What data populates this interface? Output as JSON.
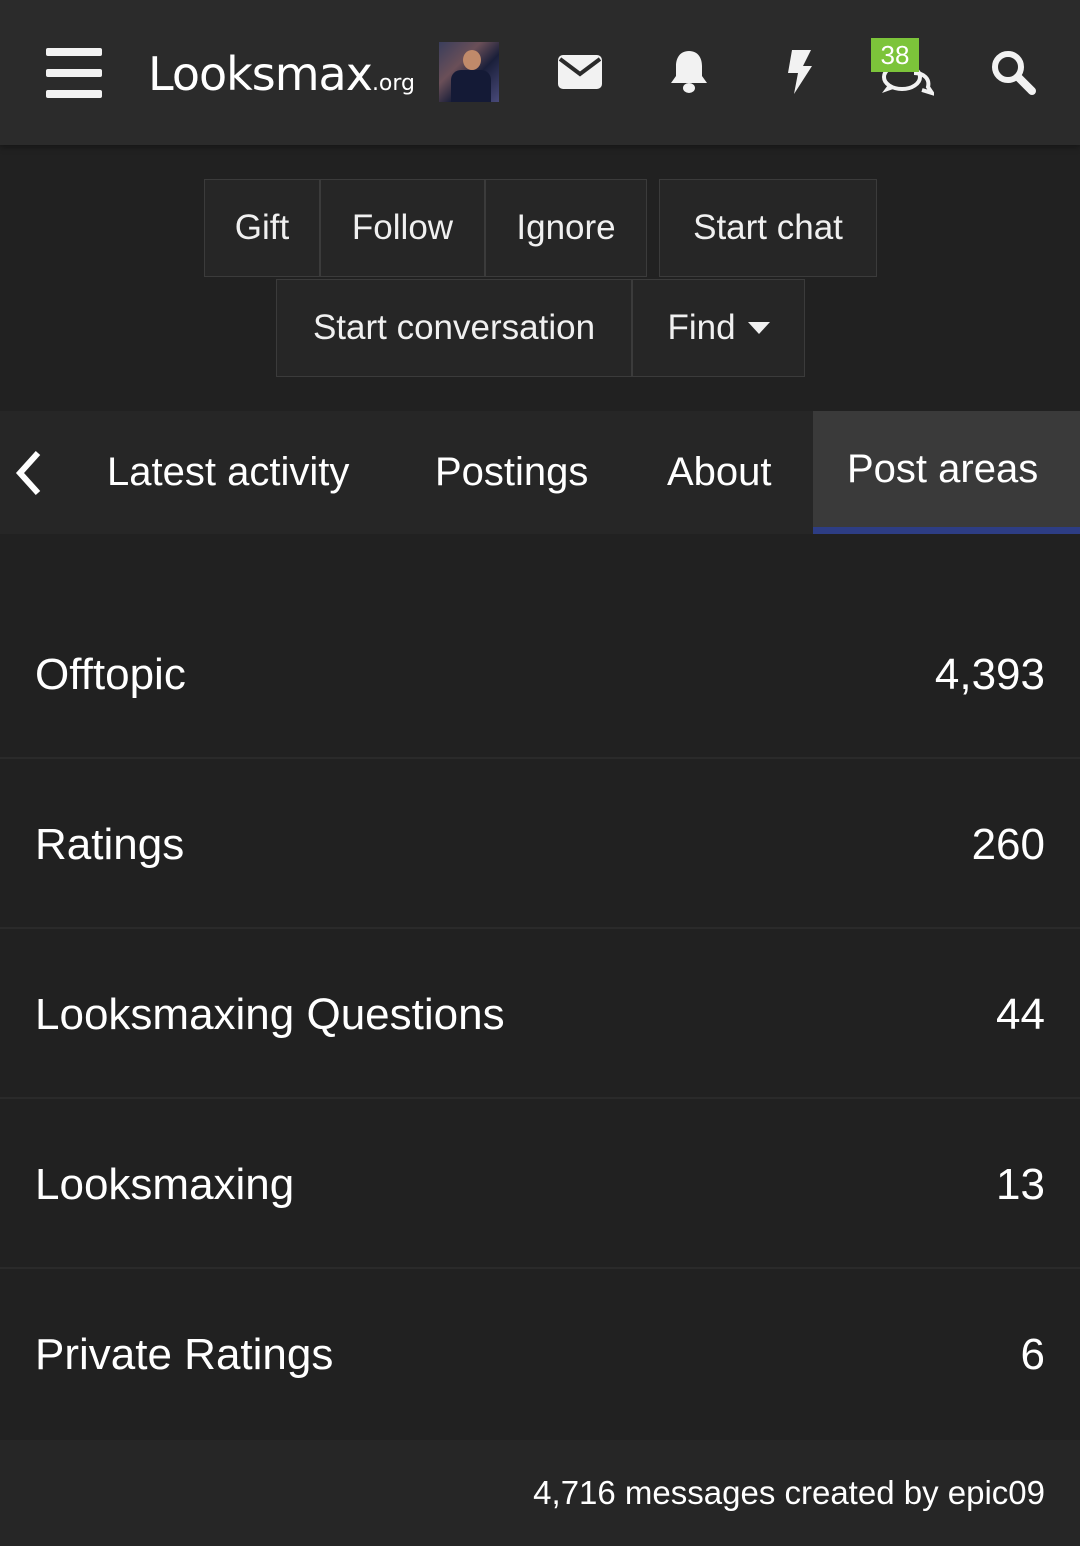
{
  "header": {
    "logo_text": "Looksmax",
    "logo_tld": ".org",
    "icons": [
      "menu-icon",
      "envelope-icon",
      "bell-icon",
      "bolt-icon",
      "chat-icon",
      "search-icon"
    ],
    "chat_badge": "38",
    "badge_color": "#7cc43a"
  },
  "actions": {
    "gift": "Gift",
    "follow": "Follow",
    "ignore": "Ignore",
    "start_chat": "Start chat",
    "start_conversation": "Start conversation",
    "find": "Find"
  },
  "tabs": {
    "items": [
      "Latest activity",
      "Postings",
      "About",
      "Post areas"
    ],
    "active": "Post areas",
    "active_underline_color": "#2d3d84"
  },
  "post_areas": [
    {
      "name": "Offtopic",
      "count": "4,393"
    },
    {
      "name": "Ratings",
      "count": "260"
    },
    {
      "name": "Looksmaxing Questions",
      "count": "44"
    },
    {
      "name": "Looksmaxing",
      "count": "13"
    },
    {
      "name": "Private Ratings",
      "count": "6"
    }
  ],
  "footer": {
    "summary": "4,716 messages created by epic09"
  }
}
